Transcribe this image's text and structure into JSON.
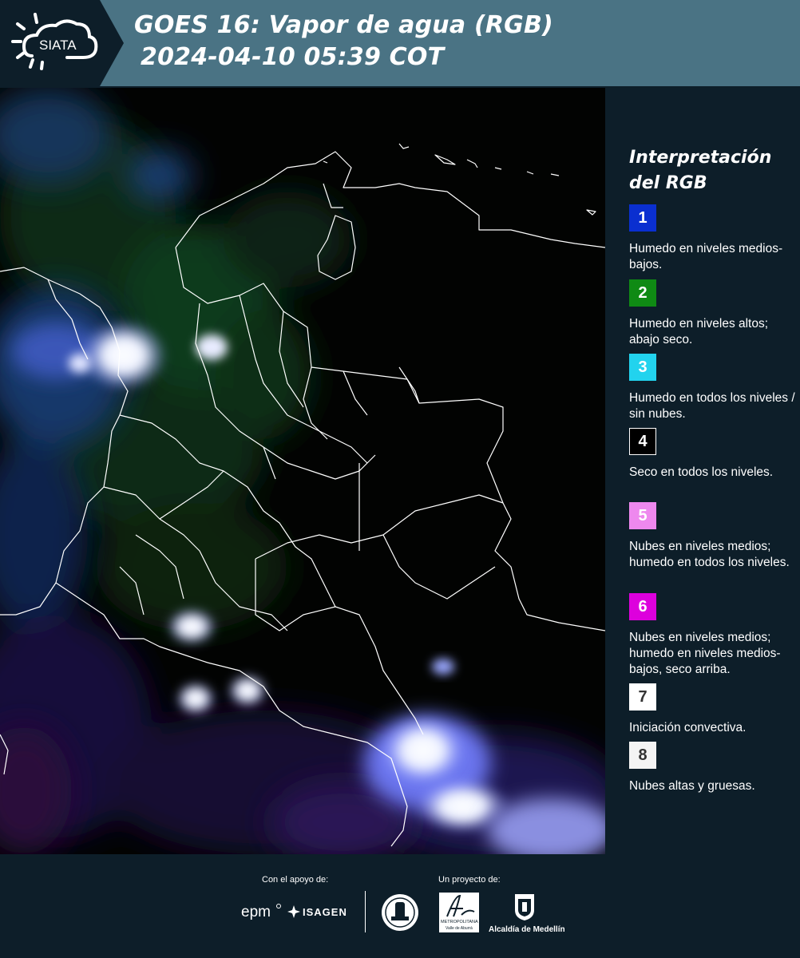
{
  "header": {
    "logo_text": "SIATA",
    "title_line1": "GOES 16: Vapor de agua (RGB)",
    "title_line2": "2024-04-10 05:39 COT"
  },
  "legend": {
    "title_line1": "Interpretación",
    "title_line2": "del RGB",
    "items": [
      {
        "number": "1",
        "text": "Humedo en niveles medios-bajos.",
        "color": "#0a2fd0",
        "text_color": "#ffffff"
      },
      {
        "number": "2",
        "text": "Humedo en niveles altos; abajo seco.",
        "color": "#0f8a14",
        "text_color": "#ffffff"
      },
      {
        "number": "3",
        "text": "Humedo en todos los niveles / sin nubes.",
        "color": "#22d3ee",
        "text_color": "#ffffff"
      },
      {
        "number": "4",
        "text": "Seco en todos los niveles.",
        "color": "#000000",
        "text_color": "#ffffff"
      },
      {
        "number": "5",
        "text": "Nubes en niveles medios; humedo en todos los niveles.",
        "color": "#ee88ee",
        "text_color": "#ffffff"
      },
      {
        "number": "6",
        "text": "Nubes en niveles medios; humedo en niveles medios-bajos, seco arriba.",
        "color": "#dd00dd",
        "text_color": "#ffffff"
      },
      {
        "number": "7",
        "text": "Iniciación convectiva.",
        "color": "#ffffff",
        "text_color": "#333333"
      },
      {
        "number": "8",
        "text": "Nubes altas y gruesas.",
        "color": "#f4f4f4",
        "text_color": "#333333"
      }
    ]
  },
  "footer": {
    "support_label": "Con el apoyo de:",
    "project_label": "Un proyecto de:",
    "sponsor_epm": "epm",
    "sponsor_isagen": "ISAGEN",
    "sponsor_area_sub": "METROPOLITANA",
    "sponsor_area_sub2": "Valle de Aburrá",
    "sponsor_alcaldia": "Alcaldía de Medellín"
  },
  "colors": {
    "header_bg": "#4a7384",
    "logo_bg": "#0d1e29",
    "panel_bg": "#0d1e29"
  }
}
